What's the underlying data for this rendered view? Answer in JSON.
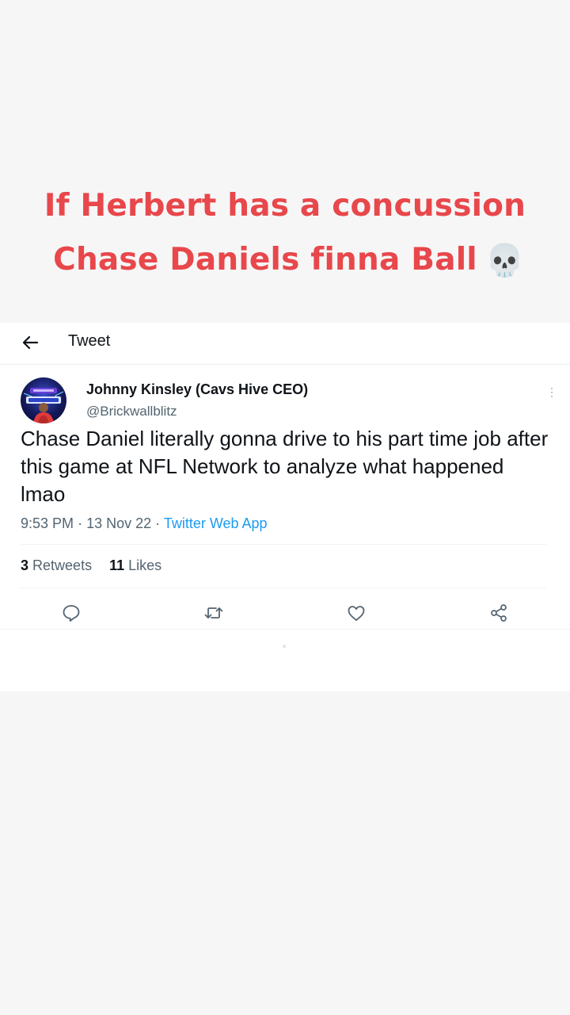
{
  "caption": {
    "line1": "If Herbert has a concussion",
    "line2": "Chase Daniels finna Ball",
    "emoji": "💀"
  },
  "header": {
    "title": "Tweet",
    "back_icon": "arrow-left-icon"
  },
  "tweet": {
    "display_name": "Johnny Kinsley (Cavs Hive CEO)",
    "handle": "@Brickwallblitz",
    "text": "Chase Daniel literally gonna drive to his part time job after this game at NFL Network to analyze what happened lmao",
    "time": "9:53 PM",
    "date": "13 Nov 22",
    "separator": "·",
    "source": "Twitter Web App",
    "retweets_count": "3",
    "retweets_label": "Retweets",
    "likes_count": "11",
    "likes_label": "Likes"
  },
  "actions": [
    "reply-icon",
    "retweet-icon",
    "like-icon",
    "share-icon"
  ],
  "colors": {
    "caption": "#e8474b",
    "link": "#1d9bf0",
    "text": "#0f1419",
    "secondary": "#536471",
    "page_background": "#f6f6f6"
  }
}
